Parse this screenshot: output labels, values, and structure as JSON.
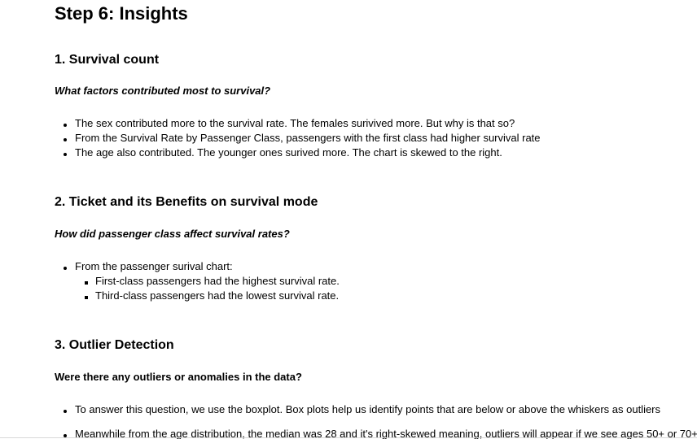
{
  "title": "Step 6: Insights",
  "sections": [
    {
      "heading": "1. Survival count",
      "question": "What factors contributed most to survival?",
      "bullets": [
        "The sex contributed more to the survival rate. The females surivived more. But why is that so?",
        "From the Survival Rate by Passenger Class, passengers with the first class had higher survival rate",
        "The age also contributed. The younger ones surived more. The chart is skewed to the right."
      ]
    },
    {
      "heading": "2. Ticket and its Benefits on survival mode",
      "question": "How did passenger class affect survival rates?",
      "bullets": [
        "From the passenger surival chart:"
      ],
      "sub_bullets": [
        "First-class passengers had the highest survival rate.",
        "Third-class passengers had the lowest survival rate."
      ]
    },
    {
      "heading": "3. Outlier Detection",
      "question": "Were there any outliers or anomalies in the data?",
      "bullets": [
        "To answer this question, we use the boxplot. Box plots help us identify points that are below or above the whiskers as outliers",
        "Meanwhile from the age distribution, the median was 28 and it's right-skewed meaning, outliers will appear if we see ages 50+ or 70+"
      ]
    }
  ]
}
